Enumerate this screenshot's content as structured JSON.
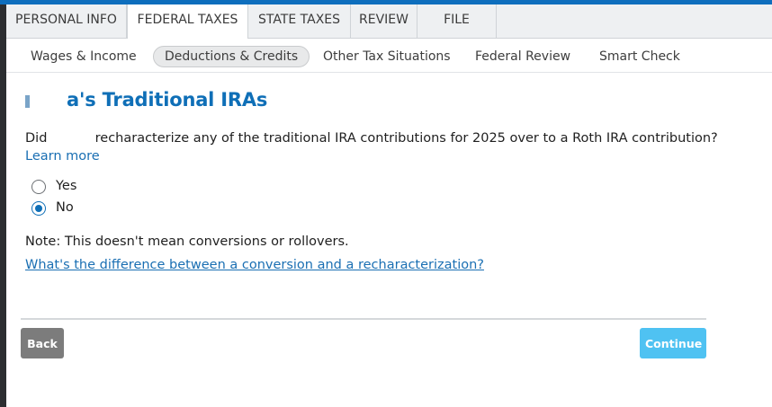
{
  "top_tabs": [
    {
      "label": "PERSONAL INFO"
    },
    {
      "label": "FEDERAL TAXES"
    },
    {
      "label": "STATE TAXES"
    },
    {
      "label": "REVIEW"
    },
    {
      "label": "FILE"
    }
  ],
  "active_top_tab": "FEDERAL TAXES",
  "sub_nav": [
    {
      "label": "Wages & Income"
    },
    {
      "label": "Deductions & Credits"
    },
    {
      "label": "Other Tax Situations"
    },
    {
      "label": "Federal Review"
    },
    {
      "label": "Smart Check"
    }
  ],
  "active_sub_nav": "Deductions & Credits",
  "page": {
    "title_suffix": "a's Traditional IRAs",
    "question_start": "Did",
    "question_rest": "recharacterize any of the traditional IRA contributions for 2025 over to a Roth IRA contribution?",
    "learn_more": "Learn more",
    "options": [
      {
        "label": "Yes",
        "selected": false
      },
      {
        "label": "No",
        "selected": true
      }
    ],
    "note": "Note: This doesn't mean conversions or rollovers.",
    "diff_link": "What's the difference between a conversion and a recharacterization?"
  },
  "buttons": {
    "back": "Back",
    "continue": "Continue"
  },
  "colors": {
    "brand": "#0e6ebd",
    "title": "#0f6fb7",
    "link": "#1a6fb3",
    "continue_bg": "#4fc2f2",
    "back_bg": "#7c7c7c"
  }
}
